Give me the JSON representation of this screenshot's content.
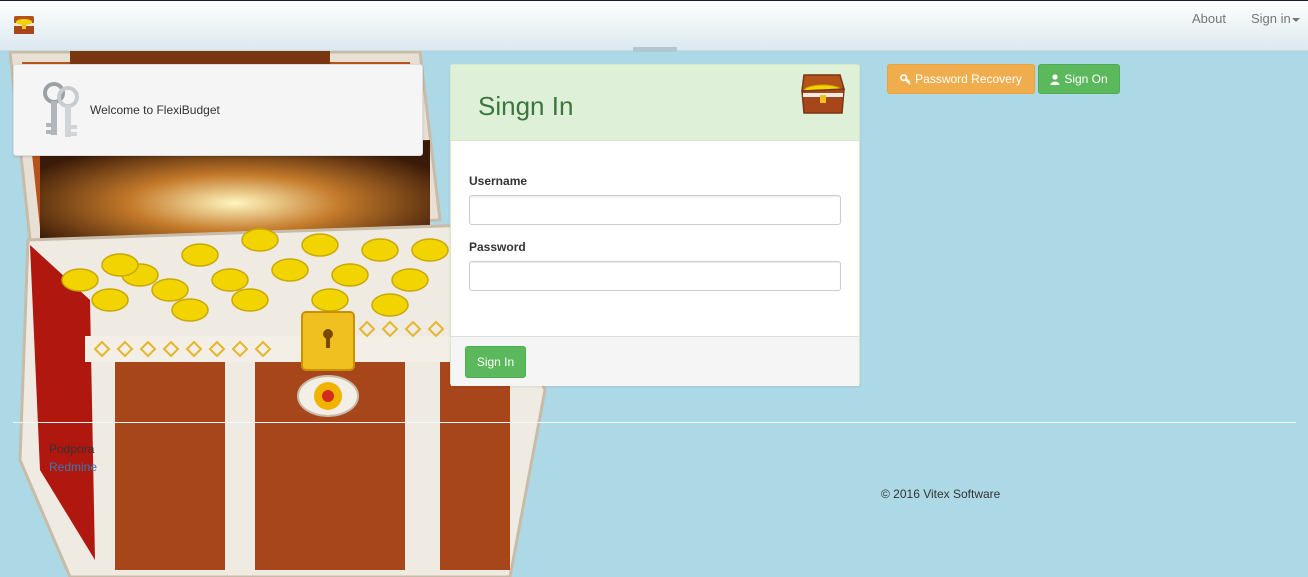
{
  "navbar": {
    "brand_icon": "treasure-chest-icon",
    "about_label": "About",
    "signin_label": "Sign in"
  },
  "welcome": {
    "icon": "keys-icon",
    "text": "Welcome to FlexiBudget"
  },
  "signin_panel": {
    "title": "Singn In",
    "icon": "treasure-chest-icon",
    "username_label": "Username",
    "username_value": "",
    "password_label": "Password",
    "password_value": "",
    "submit_label": "Sign In"
  },
  "actions": {
    "recovery_label": "Password Recovery",
    "recovery_icon": "key-icon",
    "signon_label": "Sign On",
    "signon_icon": "user-icon"
  },
  "footer": {
    "name": "Podpora",
    "link": "Redmine",
    "copyright": "© 2016 Vitex Software"
  },
  "colors": {
    "background": "#add8e6",
    "success": "#5cb85c",
    "warning": "#f0ad4e",
    "panel_heading": "#dff0d8",
    "title": "#3c763d",
    "link": "#337ab7"
  }
}
